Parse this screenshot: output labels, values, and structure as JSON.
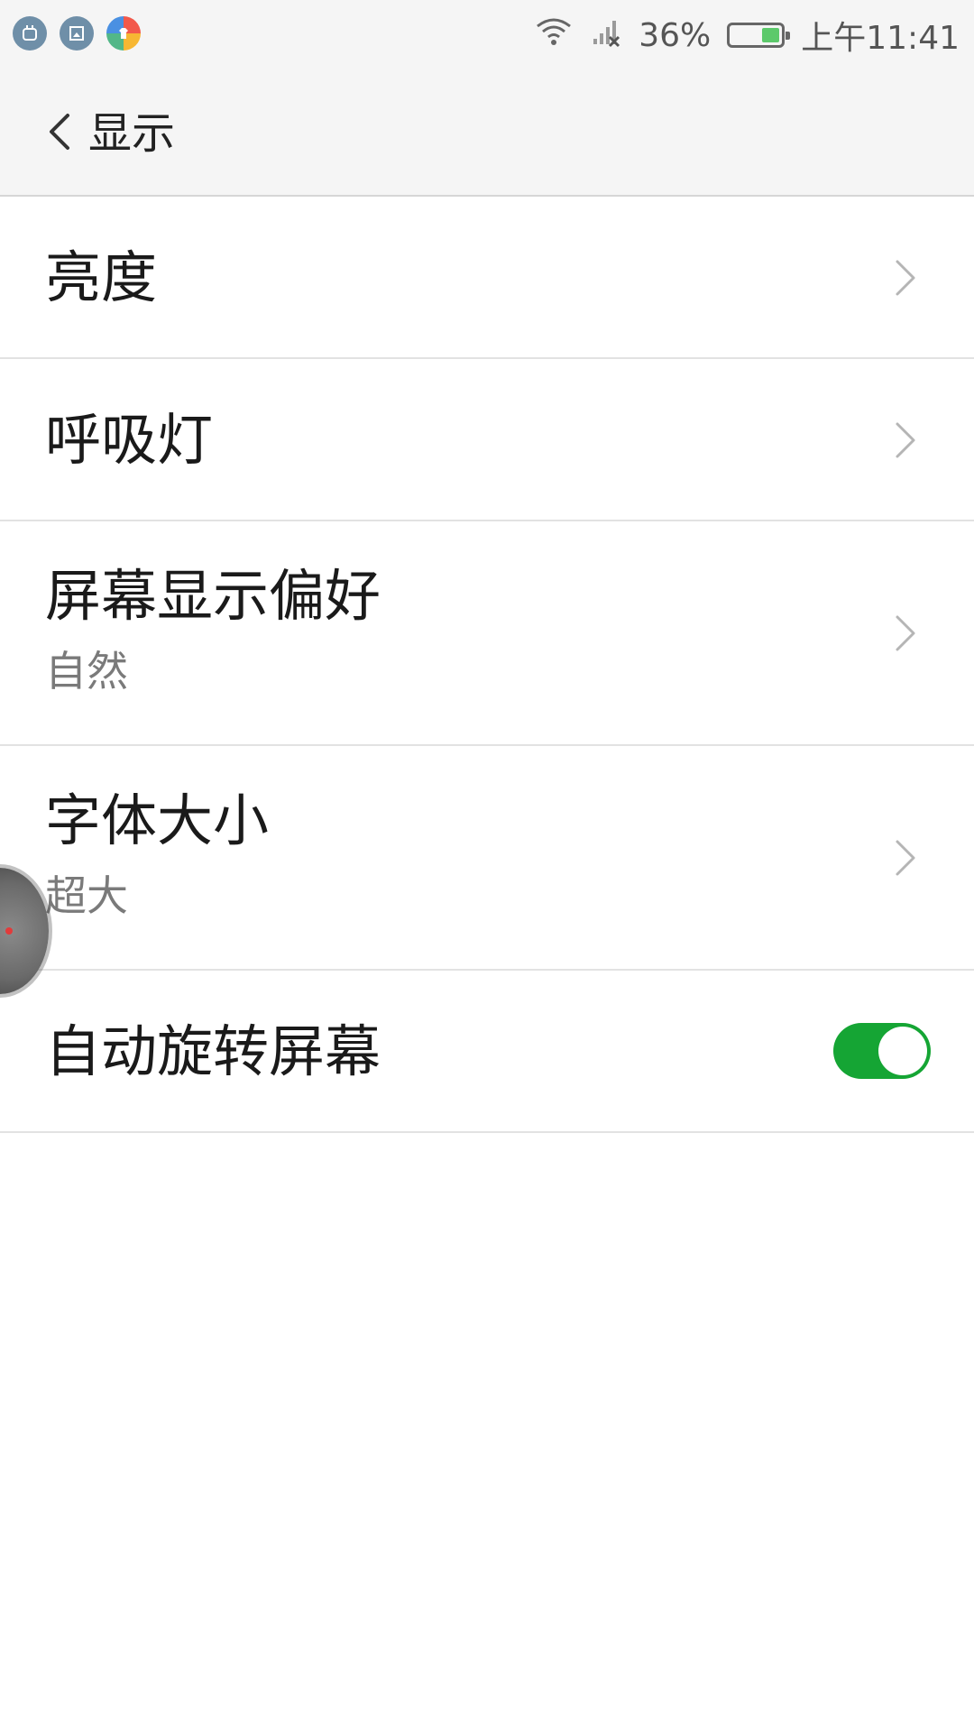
{
  "status_bar": {
    "notifications": [
      "robot-icon",
      "screenshot-icon",
      "theme-store-icon"
    ],
    "icons": [
      "wifi-icon",
      "signal-icon",
      "battery-icon"
    ],
    "battery_percent": "36%",
    "battery_level": 0.36,
    "time": "上午11:41"
  },
  "header": {
    "back_icon": "chevron-left-icon",
    "title": "显示"
  },
  "settings": [
    {
      "title": "亮度"
    },
    {
      "title": "呼吸灯"
    },
    {
      "title": "屏幕显示偏好",
      "value": "自然"
    },
    {
      "title": "字体大小",
      "value": "超大"
    },
    {
      "title": "自动旋转屏幕",
      "toggle_on": true
    }
  ],
  "colors": {
    "toggle_on": "#15a534",
    "battery_fill": "#5cc96b",
    "header_bg": "#f5f5f5"
  }
}
